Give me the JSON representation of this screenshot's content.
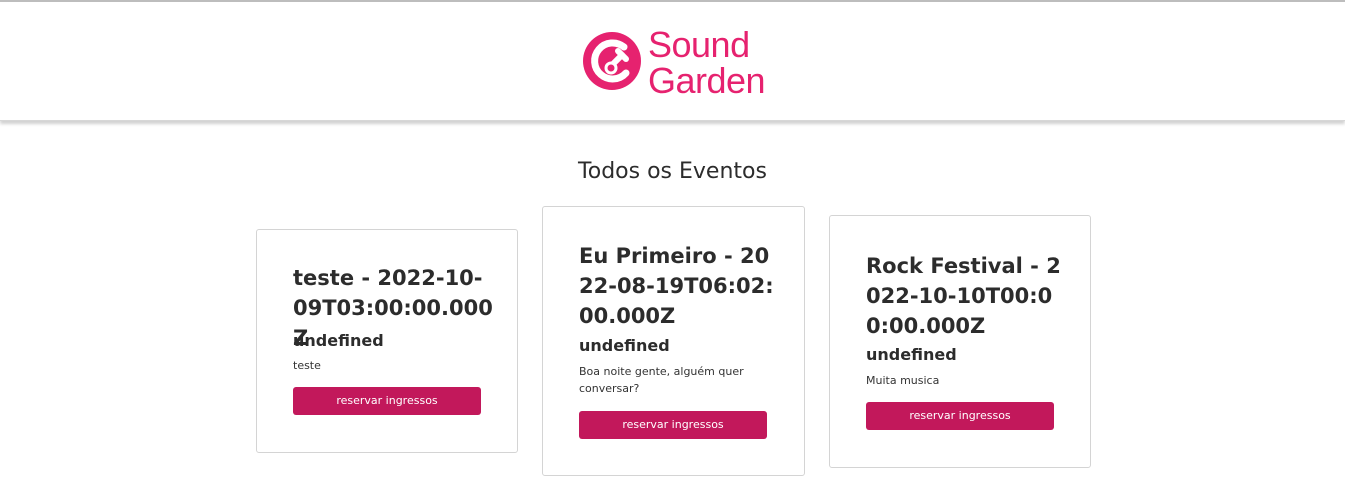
{
  "brand": {
    "line1": "Sound",
    "line2": "Garden",
    "color": "#e6226f"
  },
  "page": {
    "title": "Todos os Eventos"
  },
  "events": [
    {
      "title": "teste - 2022-10-09T03:00:00.000Z",
      "subtitle": "undefined",
      "description": "teste",
      "button_label": "reservar ingressos"
    },
    {
      "title": "Eu Primeiro - 2022-08-19T06:02:00.000Z",
      "subtitle": "undefined",
      "description": "Boa noite gente, alguém quer conversar?",
      "button_label": "reservar ingressos"
    },
    {
      "title": "Rock Festival - 2022-10-10T00:00:00.000Z",
      "subtitle": "undefined",
      "description": "Muita musica",
      "button_label": "reservar ingressos"
    }
  ],
  "colors": {
    "accent": "#e6226f",
    "button": "#c2185b"
  },
  "icons": {
    "logo": "sound-garden-logo-icon"
  }
}
